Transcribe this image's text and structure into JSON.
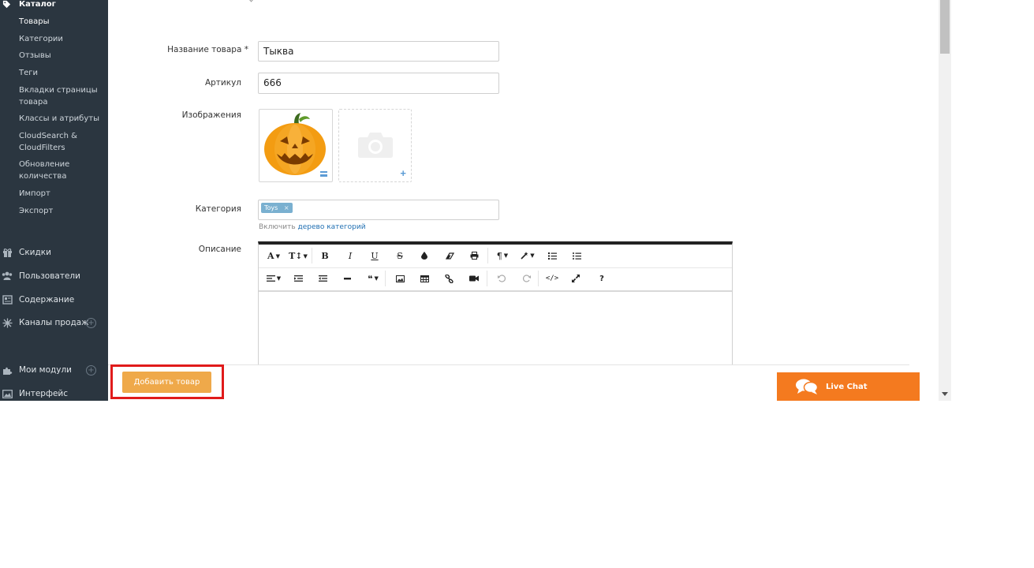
{
  "sidebar": {
    "section_title": "Каталог",
    "sub_items": [
      {
        "label": "Товары",
        "active": true
      },
      {
        "label": "Категории"
      },
      {
        "label": "Отзывы"
      },
      {
        "label": "Теги"
      },
      {
        "label": "Вкладки страницы товара"
      },
      {
        "label": "Классы и атрибуты"
      },
      {
        "label": "CloudSearch & CloudFilters"
      },
      {
        "label": "Обновление количества"
      },
      {
        "label": "Импорт"
      },
      {
        "label": "Экспорт"
      }
    ],
    "main_items": [
      {
        "label": "Скидки",
        "icon": "gift-icon"
      },
      {
        "label": "Пользователи",
        "icon": "users-icon"
      },
      {
        "label": "Содержание",
        "icon": "newspaper-icon"
      },
      {
        "label": "Каналы продаж",
        "icon": "network-icon",
        "plus": true
      },
      {
        "label": "Мои модули",
        "icon": "puzzle-icon",
        "plus": true
      },
      {
        "label": "Интерфейс",
        "icon": "image-icon"
      }
    ]
  },
  "form": {
    "name_label": "Название товара",
    "name_value": "Тыква",
    "sku_label": "Артикул",
    "sku_value": "666",
    "images_label": "Изображения",
    "category_label": "Категория",
    "category_tag": "Toys",
    "category_hint": "Включить",
    "category_hint_link": "дерево категорий",
    "description_label": "Описание"
  },
  "editor": {
    "toolbar_row1": [
      "A",
      "T↕",
      "B",
      "I",
      "U",
      "S",
      "drop",
      "eraser",
      "print",
      "¶",
      "wand",
      "ol",
      "ul"
    ],
    "toolbar_row2": [
      "align",
      "indent",
      "outdent",
      "hr",
      "quote",
      "image",
      "table",
      "link",
      "video",
      "undo",
      "redo",
      "code",
      "fullscreen",
      "?"
    ]
  },
  "actions": {
    "add_product": "Добавить товар",
    "live_chat": "Live Chat"
  },
  "colors": {
    "sidebar_bg": "#2b3640",
    "add_button": "#efa94a",
    "live_chat": "#f47a1f",
    "highlight": "#e01b1b",
    "tag": "#7ab0d0",
    "link": "#1f6fb2"
  }
}
